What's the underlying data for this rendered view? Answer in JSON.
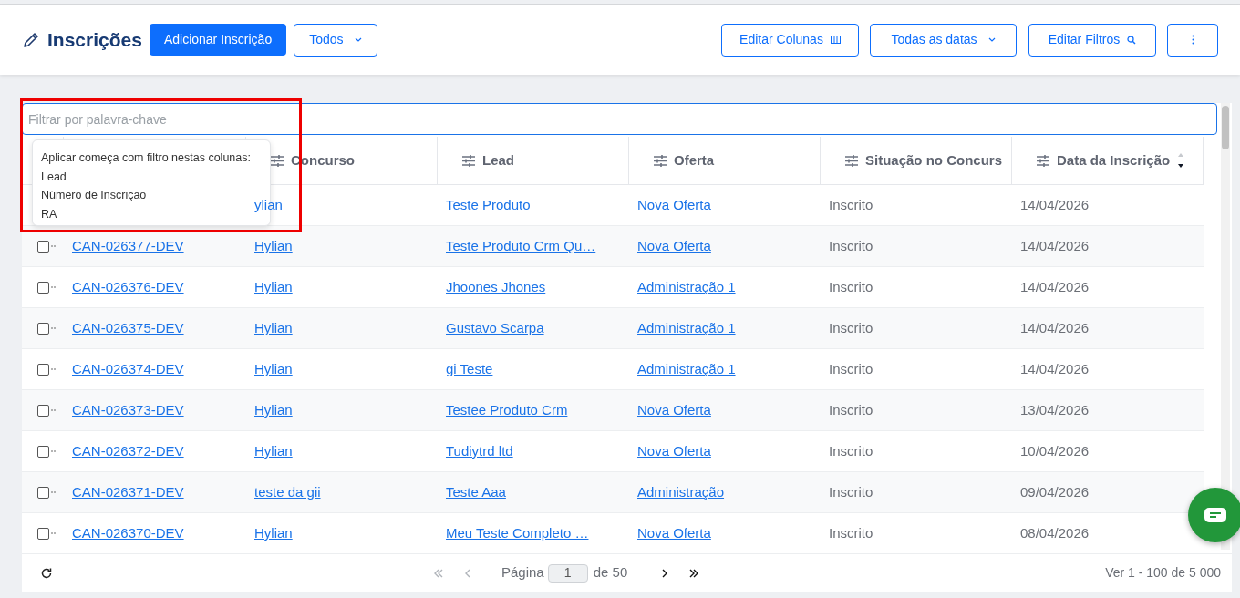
{
  "header": {
    "title": "Inscrições",
    "add_button": "Adicionar Inscrição",
    "status_dropdown": "Todos",
    "edit_columns_button": "Editar Colunas",
    "date_dropdown": "Todas as datas",
    "edit_filters_button": "Editar Filtros"
  },
  "filter": {
    "placeholder": "Filtrar por palavra-chave"
  },
  "filter_popup": {
    "heading": "Aplicar começa com filtro nestas colunas:",
    "columns": [
      "Lead",
      "Número de Inscrição",
      "RA"
    ]
  },
  "table": {
    "columns": [
      {},
      {
        "label": "Concurso"
      },
      {
        "label": "Lead"
      },
      {
        "label": "Oferta"
      },
      {
        "label": "Situação no Concurs"
      },
      {
        "label": "Data da Inscrição",
        "sort_descending": true
      }
    ],
    "rows": [
      {
        "cells": [
          null,
          "ylian",
          "Teste Produto",
          "Nova Oferta",
          "Inscrito",
          "14/04/2026"
        ]
      },
      {
        "checked": false,
        "cells": [
          "CAN-026377-DEV",
          "Hylian",
          "Teste Produto Crm Qu…",
          "Nova Oferta",
          "Inscrito",
          "14/04/2026"
        ]
      },
      {
        "checked": false,
        "cells": [
          "CAN-026376-DEV",
          "Hylian",
          "Jhoones Jhones",
          "Administração 1",
          "Inscrito",
          "14/04/2026"
        ]
      },
      {
        "checked": false,
        "cells": [
          "CAN-026375-DEV",
          "Hylian",
          "Gustavo Scarpa",
          "Administração 1",
          "Inscrito",
          "14/04/2026"
        ]
      },
      {
        "checked": false,
        "cells": [
          "CAN-026374-DEV",
          "Hylian",
          "gi Teste",
          "Administração 1",
          "Inscrito",
          "14/04/2026"
        ]
      },
      {
        "checked": false,
        "cells": [
          "CAN-026373-DEV",
          "Hylian",
          "Testee Produto Crm",
          "Nova Oferta",
          "Inscrito",
          "13/04/2026"
        ]
      },
      {
        "checked": false,
        "cells": [
          "CAN-026372-DEV",
          "Hylian",
          "Tudiytrd ltd",
          "Nova Oferta",
          "Inscrito",
          "10/04/2026"
        ]
      },
      {
        "checked": false,
        "cells": [
          "CAN-026371-DEV",
          "teste da gii",
          "Teste Aaa",
          "Administração",
          "Inscrito",
          "09/04/2026"
        ]
      },
      {
        "checked": false,
        "cells": [
          "CAN-026370-DEV",
          "Hylian",
          "Meu Teste Completo …",
          "Nova Oferta",
          "Inscrito",
          "08/04/2026"
        ]
      }
    ]
  },
  "pagination": {
    "first_disabled": true,
    "prev_disabled": true,
    "next_disabled": false,
    "last_disabled": false,
    "page_label": "Página",
    "page": "1",
    "of_label": "de 50",
    "summary": "Ver 1 - 100 de 5 000"
  }
}
